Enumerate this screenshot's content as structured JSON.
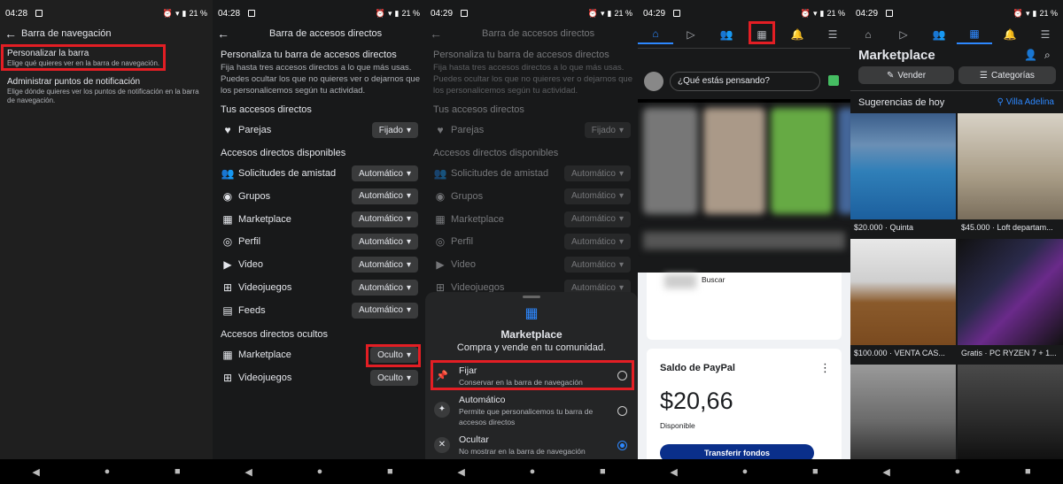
{
  "status": {
    "time1": "04:28",
    "time2": "04:28",
    "time3": "04:29",
    "time4": "04:29",
    "time5": "04:29",
    "battery": "21 %"
  },
  "p1": {
    "title": "Barra de navegación",
    "item1_title": "Personalizar la barra",
    "item1_sub": "Elige qué quieres ver en la barra de navegación.",
    "item2_title": "Administrar puntos de notificación",
    "item2_sub": "Elige dónde quieres ver los puntos de notificación en la barra de navegación."
  },
  "p2": {
    "title": "Barra de accesos directos",
    "heading": "Personaliza tu barra de accesos directos",
    "desc": "Fija hasta tres accesos directos a lo que más usas. Puedes ocultar los que no quieres ver o dejarnos que los personalicemos según tu actividad.",
    "sec1": "Tus accesos directos",
    "sec2": "Accesos directos disponibles",
    "sec3": "Accesos directos ocultos",
    "pinned": [
      {
        "label": "Parejas",
        "value": "Fijado",
        "icon": "heart-icon"
      }
    ],
    "available": [
      {
        "label": "Solicitudes de amistad",
        "value": "Automático",
        "icon": "friends-icon"
      },
      {
        "label": "Grupos",
        "value": "Automático",
        "icon": "groups-icon"
      },
      {
        "label": "Marketplace",
        "value": "Automático",
        "icon": "store-icon"
      },
      {
        "label": "Perfil",
        "value": "Automático",
        "icon": "profile-icon"
      },
      {
        "label": "Video",
        "value": "Automático",
        "icon": "video-icon"
      },
      {
        "label": "Videojuegos",
        "value": "Automático",
        "icon": "gaming-icon"
      },
      {
        "label": "Feeds",
        "value": "Automático",
        "icon": "feeds-icon"
      }
    ],
    "hidden": [
      {
        "label": "Marketplace",
        "value": "Oculto",
        "icon": "store-icon"
      },
      {
        "label": "Videojuegos",
        "value": "Oculto",
        "icon": "gaming-icon"
      }
    ]
  },
  "p3": {
    "sheet_title": "Marketplace",
    "sheet_sub": "Compra y vende en tu comunidad.",
    "opt1_title": "Fijar",
    "opt1_sub": "Conservar en la barra de navegación",
    "opt2_title": "Automático",
    "opt2_sub": "Permite que personalicemos tu barra de accesos directos",
    "opt3_title": "Ocultar",
    "opt3_sub": "No mostrar en la barra de navegación"
  },
  "p4": {
    "composer": "¿Qué estás pensando?",
    "buscar": "Buscar",
    "paypal_title": "Saldo de PayPal",
    "paypal_amount": "$20,66",
    "paypal_status": "Disponible",
    "paypal_button": "Transferir fondos"
  },
  "p5": {
    "title": "Marketplace",
    "sell": "Vender",
    "categories": "Categorías",
    "suggest": "Sugerencias de hoy",
    "location": "Villa Adelina",
    "listings": [
      {
        "text": "$20.000 · Quinta"
      },
      {
        "text": "$45.000 · Loft departam..."
      },
      {
        "text": "$100.000 · VENTA CAS..."
      },
      {
        "text": "Gratis · PC RYZEN 7 + 1..."
      }
    ]
  }
}
